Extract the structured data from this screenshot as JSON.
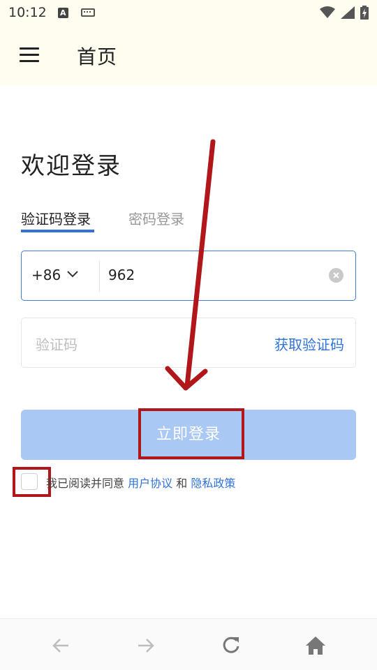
{
  "status_bar": {
    "time": "10:12",
    "icons": [
      "a-notification-icon",
      "keyboard-icon",
      "wifi-icon",
      "signal-icon",
      "battery-charging-icon"
    ]
  },
  "header": {
    "title": "首页",
    "menu_icon": "hamburger-menu-icon"
  },
  "login": {
    "welcome": "欢迎登录",
    "tabs": [
      {
        "label": "验证码登录",
        "active": true
      },
      {
        "label": "密码登录",
        "active": false
      }
    ],
    "phone": {
      "country_code": "+86",
      "value": "962",
      "clear_icon": "clear-circle-icon"
    },
    "code": {
      "placeholder": "验证码",
      "get_code_label": "获取验证码"
    },
    "submit_label": "立即登录",
    "agreement": {
      "prefix": "我已阅读并同意",
      "user_agreement": "用户协议",
      "and": "和",
      "privacy_policy": "隐私政策"
    }
  },
  "bottom_nav": {
    "icons": [
      "back-arrow-icon",
      "forward-arrow-icon",
      "refresh-icon",
      "home-icon"
    ]
  },
  "colors": {
    "accent": "#2f73d9",
    "button_disabled": "#a9c8f3",
    "annotation_red": "#b0161a",
    "header_bg": "#fffdf0"
  }
}
